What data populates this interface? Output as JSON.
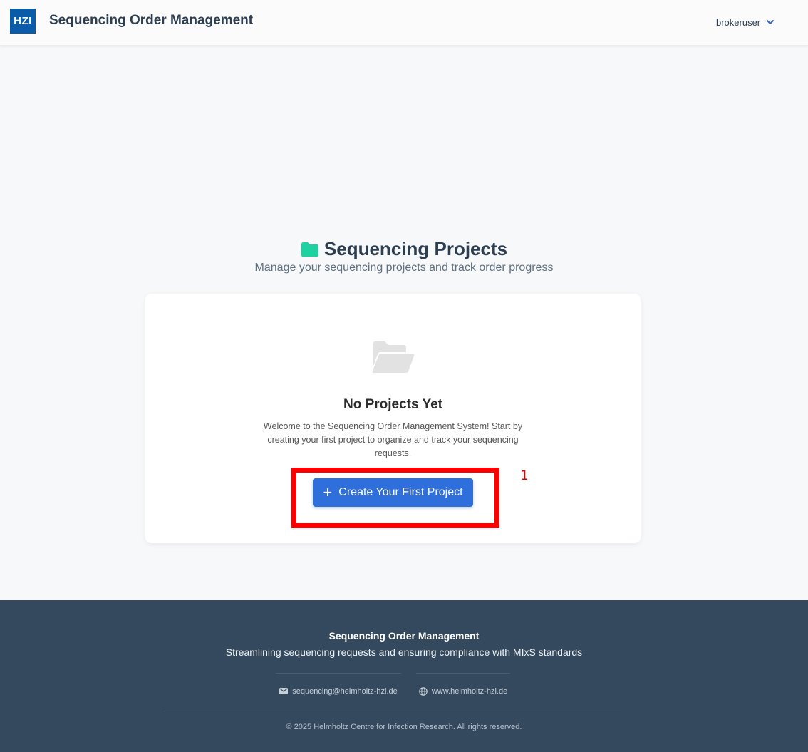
{
  "header": {
    "logo_text": "HZI",
    "app_title": "Sequencing Order Management",
    "username": "brokeruser",
    "user_menu_icon": "chevron-down-icon"
  },
  "main": {
    "title": "Sequencing Projects",
    "title_icon": "folder-icon",
    "subtitle": "Manage your sequencing projects and track order progress",
    "empty_state": {
      "icon": "folder-open-icon",
      "title": "No Projects Yet",
      "text": "Welcome to the Sequencing Order Management System! Start by creating your first project to organize and track your sequencing requests.",
      "button_label": "Create Your First Project",
      "button_icon": "plus-icon"
    }
  },
  "annotation": {
    "label": "1",
    "color": "#ff0000"
  },
  "footer": {
    "title": "Sequencing Order Management",
    "tagline": "Streamlining sequencing requests and ensuring compliance with MIxS standards",
    "email": "sequencing@helmholtz-hzi.de",
    "website": "www.helmholtz-hzi.de",
    "copyright": "© 2025 Helmholtz Centre for Infection Research. All rights reserved."
  },
  "colors": {
    "brand": "#0a5ca8",
    "accent_teal": "#1dd1a1",
    "button_blue": "#2f6fdc",
    "footer_bg": "#34495e"
  }
}
